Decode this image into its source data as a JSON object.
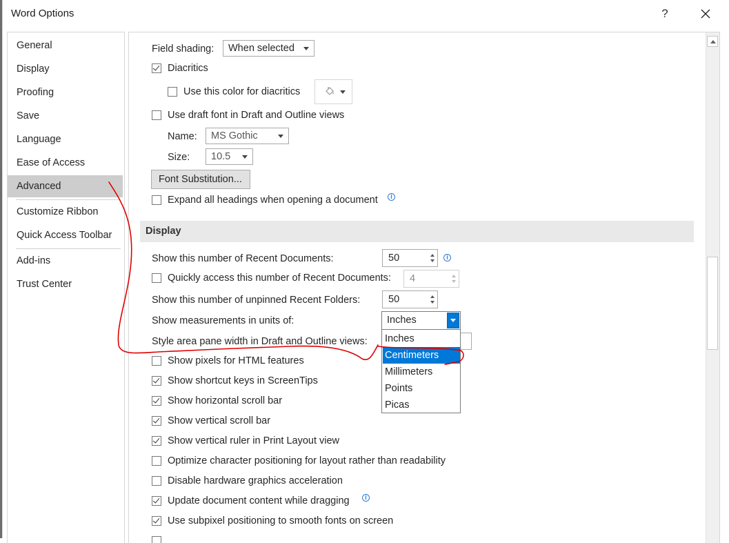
{
  "window": {
    "title": "Word Options",
    "help_label": "?",
    "close_label": "Close"
  },
  "nav": {
    "items": [
      {
        "label": "General"
      },
      {
        "label": "Display"
      },
      {
        "label": "Proofing"
      },
      {
        "label": "Save"
      },
      {
        "label": "Language"
      },
      {
        "label": "Ease of Access"
      },
      {
        "label": "Advanced",
        "selected": true
      },
      {
        "label": "Customize Ribbon"
      },
      {
        "label": "Quick Access Toolbar"
      },
      {
        "label": "Add-ins"
      },
      {
        "label": "Trust Center"
      }
    ]
  },
  "content": {
    "field_shading": {
      "label": "Field shading:",
      "value": "When selected"
    },
    "diacritics": {
      "label": "Diacritics",
      "checked": true
    },
    "diacritics_color": {
      "label": "Use this color for diacritics",
      "checked": false
    },
    "draft_font": {
      "label": "Use draft font in Draft and Outline views",
      "checked": false
    },
    "font_name": {
      "label": "Name:",
      "value": "MS Gothic"
    },
    "font_size": {
      "label": "Size:",
      "value": "10.5"
    },
    "font_substitution_button": "Font Substitution...",
    "expand_headings": {
      "label": "Expand all headings when opening a document",
      "checked": false
    },
    "display_section": {
      "title": "Display",
      "recent_docs": {
        "label": "Show this number of Recent Documents:",
        "value": "50"
      },
      "quick_access": {
        "label": "Quickly access this number of Recent Documents:",
        "value": "4",
        "checked": false
      },
      "recent_folders": {
        "label": "Show this number of unpinned Recent Folders:",
        "value": "50"
      },
      "units": {
        "label": "Show measurements in units of:",
        "value": "Inches",
        "options": [
          "Inches",
          "Centimeters",
          "Millimeters",
          "Points",
          "Picas"
        ],
        "highlighted": "Centimeters"
      },
      "style_area": {
        "label": "Style area pane width in Draft and Outline views:"
      },
      "checkboxes": [
        {
          "label": "Show pixels for HTML features",
          "checked": false
        },
        {
          "label": "Show shortcut keys in ScreenTips",
          "checked": true
        },
        {
          "label": "Show horizontal scroll bar",
          "checked": true
        },
        {
          "label": "Show vertical scroll bar",
          "checked": true
        },
        {
          "label": "Show vertical ruler in Print Layout view",
          "checked": true
        },
        {
          "label": "Optimize character positioning for layout rather than readability",
          "checked": false
        },
        {
          "label": "Disable hardware graphics acceleration",
          "checked": false
        },
        {
          "label": "Update document content while dragging",
          "checked": true
        },
        {
          "label": "Use subpixel positioning to smooth fonts on screen",
          "checked": true
        }
      ]
    }
  },
  "colors": {
    "selection_blue": "#0078d7",
    "nav_selected": "#cdcdcd",
    "annotation_red": "#e00000"
  }
}
